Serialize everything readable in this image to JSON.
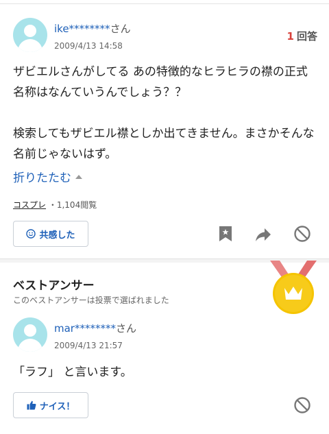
{
  "question": {
    "user": {
      "name": "ike********",
      "suffix": "さん"
    },
    "date": "2009/4/13 14:58",
    "answer_count": {
      "number": "1",
      "label": "回答"
    },
    "body": [
      "ザビエルさんがしてる あの特徴的なヒラヒラの襟の正式名称はなんていうんでしょう？？",
      "",
      "検索してもザビエル襟としか出てきません。まさかそんな名前じゃないはず。"
    ],
    "collapse_label": "折りたたむ",
    "category": "コスプレ",
    "views": "・1,104閲覧",
    "empathy_button": "共感した"
  },
  "best_answer": {
    "title": "ベストアンサー",
    "subtitle": "このベストアンサーは投票で選ばれました",
    "user": {
      "name": "mar********",
      "suffix": "さん"
    },
    "date": "2009/4/13 21:57",
    "body": "「ラフ」 と言います。",
    "nice_button": "ナイス！"
  },
  "colors": {
    "link": "#1e60b8",
    "count": "#d8403a",
    "avatar": "#a8e3ea",
    "medal_gold": "#f5c400",
    "ribbon": "#e88585"
  },
  "icons": [
    "bookmark-icon",
    "share-icon",
    "block-icon",
    "smile-icon",
    "thumbs-up-icon",
    "crown-medal-icon"
  ]
}
